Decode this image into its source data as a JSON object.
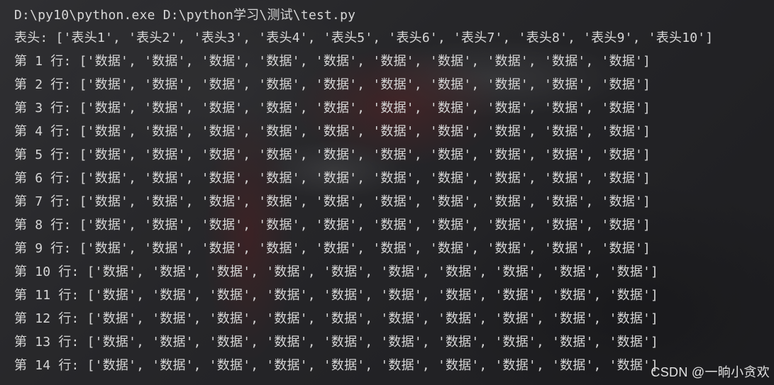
{
  "console": {
    "command": "D:\\py10\\python.exe D:\\python学习\\测试\\test.py",
    "header_line": "表头: ['表头1', '表头2', '表头3', '表头4', '表头5', '表头6', '表头7', '表头8', '表头9', '表头10']",
    "rows": [
      "第 1 行: ['数据', '数据', '数据', '数据', '数据', '数据', '数据', '数据', '数据', '数据']",
      "第 2 行: ['数据', '数据', '数据', '数据', '数据', '数据', '数据', '数据', '数据', '数据']",
      "第 3 行: ['数据', '数据', '数据', '数据', '数据', '数据', '数据', '数据', '数据', '数据']",
      "第 4 行: ['数据', '数据', '数据', '数据', '数据', '数据', '数据', '数据', '数据', '数据']",
      "第 5 行: ['数据', '数据', '数据', '数据', '数据', '数据', '数据', '数据', '数据', '数据']",
      "第 6 行: ['数据', '数据', '数据', '数据', '数据', '数据', '数据', '数据', '数据', '数据']",
      "第 7 行: ['数据', '数据', '数据', '数据', '数据', '数据', '数据', '数据', '数据', '数据']",
      "第 8 行: ['数据', '数据', '数据', '数据', '数据', '数据', '数据', '数据', '数据', '数据']",
      "第 9 行: ['数据', '数据', '数据', '数据', '数据', '数据', '数据', '数据', '数据', '数据']",
      "第 10 行: ['数据', '数据', '数据', '数据', '数据', '数据', '数据', '数据', '数据', '数据']",
      "第 11 行: ['数据', '数据', '数据', '数据', '数据', '数据', '数据', '数据', '数据', '数据']",
      "第 12 行: ['数据', '数据', '数据', '数据', '数据', '数据', '数据', '数据', '数据', '数据']",
      "第 13 行: ['数据', '数据', '数据', '数据', '数据', '数据', '数据', '数据', '数据', '数据']",
      "第 14 行: ['数据', '数据', '数据', '数据', '数据', '数据', '数据', '数据', '数据', '数据']"
    ]
  },
  "watermark": "CSDN @一晌小贪欢",
  "colors": {
    "text": "#d7d7d7",
    "background": "#2b2b2d"
  }
}
